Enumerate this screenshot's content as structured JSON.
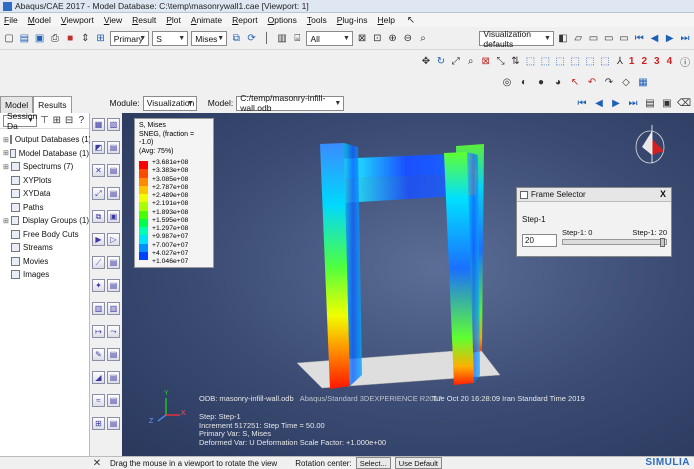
{
  "window": {
    "title": "Abaqus/CAE 2017 - Model Database: C:\\temp\\masonrywall1.cae [Viewport: 1]"
  },
  "menu": [
    "File",
    "Model",
    "Viewport",
    "View",
    "Result",
    "Plot",
    "Animate",
    "Report",
    "Options",
    "Tools",
    "Plug-ins",
    "Help"
  ],
  "toolbar": {
    "variable_type": "Primary",
    "field_output": "S",
    "invariant": "Mises",
    "display_group_filter": "All",
    "visualization_defaults": "Visualization defaults",
    "view_numbers": [
      "1",
      "2",
      "3",
      "4"
    ]
  },
  "module_bar": {
    "tabs": [
      "Model",
      "Results"
    ],
    "active_tab": "Results",
    "module_label": "Module:",
    "module_value": "Visualization",
    "model_label": "Model:",
    "model_value": "C:/temp/masonry-infill-wall.odb"
  },
  "results_tree": {
    "session_label": "Session Da",
    "items": [
      "Output Databases (1)",
      "Model Database (1)",
      "Spectrums (7)",
      "XYPlots",
      "XYData",
      "Paths",
      "Display Groups (1)",
      "Free Body Cuts",
      "Streams",
      "Movies",
      "Images"
    ]
  },
  "legend": {
    "title_lines": [
      "S, Mises",
      "SNEG, (fraction = -1.0)",
      "(Avg: 75%)"
    ],
    "values": [
      "+3.681e+08",
      "+3.383e+08",
      "+3.085e+08",
      "+2.787e+08",
      "+2.489e+08",
      "+2.191e+08",
      "+1.893e+08",
      "+1.595e+08",
      "+1.297e+08",
      "+9.987e+07",
      "+7.007e+07",
      "+4.027e+07",
      "+1.046e+07"
    ],
    "colors": [
      "#ff0000",
      "#ff4a00",
      "#ff8a00",
      "#ffc400",
      "#f0ff00",
      "#a8ff00",
      "#48ff00",
      "#00ff4a",
      "#00ffb0",
      "#00e0ff",
      "#0090ff",
      "#0040ff",
      "#0000ff"
    ]
  },
  "frame_selector": {
    "title": "Frame Selector",
    "close": "X",
    "step": "Step-1",
    "frame_value": "20",
    "range_min": "Step-1: 0",
    "range_max": "Step-1: 20",
    "slider_position": 1.0
  },
  "viewport_info": {
    "odb": "ODB: masonry-infill-wall.odb",
    "odb_suffix": "Abaqus/Standard 3DEXPERIENCE R2017",
    "date": "Tue Oct 20 16:28:09 Iran Standard Time 2019",
    "step": "Step: Step-1",
    "increment": "Increment    517251: Step Time =    50.00",
    "primary_var": "Primary Var: S, Mises",
    "deformed_var": "Deformed Var: U   Deformation Scale Factor: +1.000e+00"
  },
  "triad": {
    "x": "X",
    "y": "Y",
    "z": "Z"
  },
  "status_bar": {
    "hint": "Drag the mouse in a viewport to rotate the view",
    "rotation_center_label": "Rotation center:",
    "select_button": "Select...",
    "use_default_button": "Use Default"
  },
  "brand": "SIMULIA"
}
